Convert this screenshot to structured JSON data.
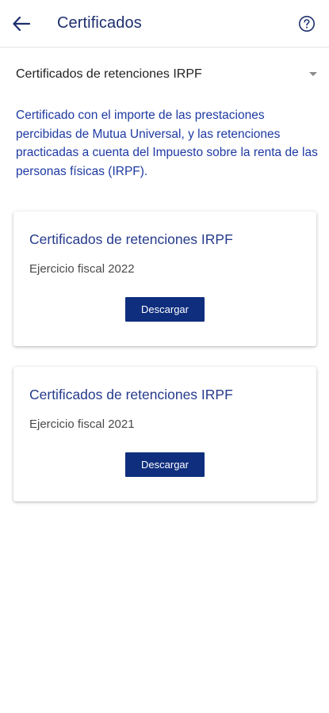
{
  "header": {
    "title": "Certificados",
    "back_icon": "arrow-left-icon",
    "help_icon": "question-circle-icon"
  },
  "selector": {
    "value": "Certificados de retenciones IRPF",
    "icon": "caret-down-icon"
  },
  "description": "Certificado con el importe de las prestaciones percibidas de Mutua Universal, y las retenciones practicadas a cuenta del Impuesto sobre la renta de las personas físicas (IRPF).",
  "certificates": [
    {
      "title": "Certificados de retenciones IRPF",
      "subtitle": "Ejercicio fiscal 2022",
      "button_label": "Descargar"
    },
    {
      "title": "Certificados de retenciones IRPF",
      "subtitle": "Ejercicio fiscal 2021",
      "button_label": "Descargar"
    }
  ],
  "colors": {
    "primary": "#0f2e7e",
    "title_text": "#1e2f6e",
    "description_text": "#1e3aa3"
  }
}
